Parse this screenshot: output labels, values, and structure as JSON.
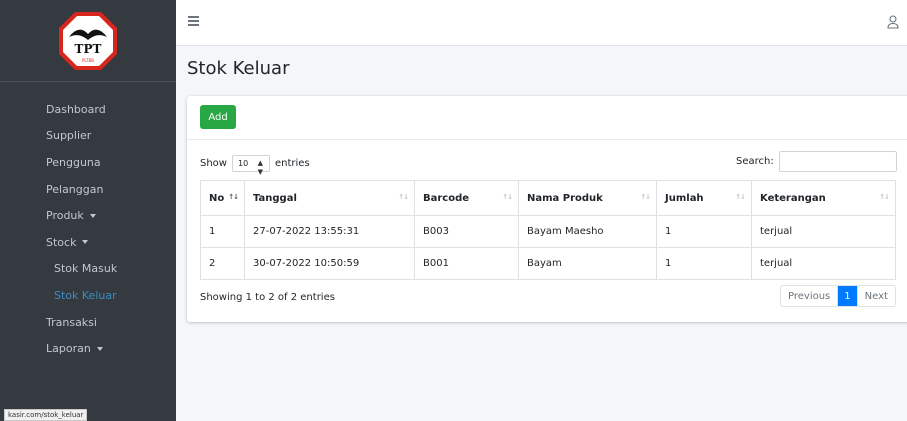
{
  "logo": {
    "text": "TPT",
    "subtext": "PLTBB"
  },
  "sidebar": {
    "items": [
      {
        "label": "Dashboard"
      },
      {
        "label": "Supplier"
      },
      {
        "label": "Pengguna"
      },
      {
        "label": "Pelanggan"
      },
      {
        "label": "Produk"
      },
      {
        "label": "Stock"
      },
      {
        "label": "Stok Masuk"
      },
      {
        "label": "Stok Keluar"
      },
      {
        "label": "Transaksi"
      },
      {
        "label": "Laporan"
      }
    ],
    "active_color": "#3c8dbc"
  },
  "status_url": "kasir.com/stok_keluar",
  "page": {
    "title": "Stok Keluar"
  },
  "toolbar": {
    "add_label": "Add"
  },
  "length": {
    "prefix": "Show",
    "value": "10",
    "suffix": "entries"
  },
  "search": {
    "label": "Search:",
    "value": ""
  },
  "table": {
    "headers": [
      "No",
      "Tanggal",
      "Barcode",
      "Nama Produk",
      "Jumlah",
      "Keterangan"
    ],
    "rows": [
      [
        "1",
        "27-07-2022 13:55:31",
        "B003",
        "Bayam Maesho",
        "1",
        "terjual"
      ],
      [
        "2",
        "30-07-2022 10:50:59",
        "B001",
        "Bayam",
        "1",
        "terjual"
      ]
    ]
  },
  "info": "Showing 1 to 2 of 2 entries",
  "pagination": {
    "previous": "Previous",
    "current": "1",
    "next": "Next"
  },
  "colors": {
    "sidebar": "#343a40",
    "add_button": "#28a745",
    "page_active": "#007bff"
  }
}
